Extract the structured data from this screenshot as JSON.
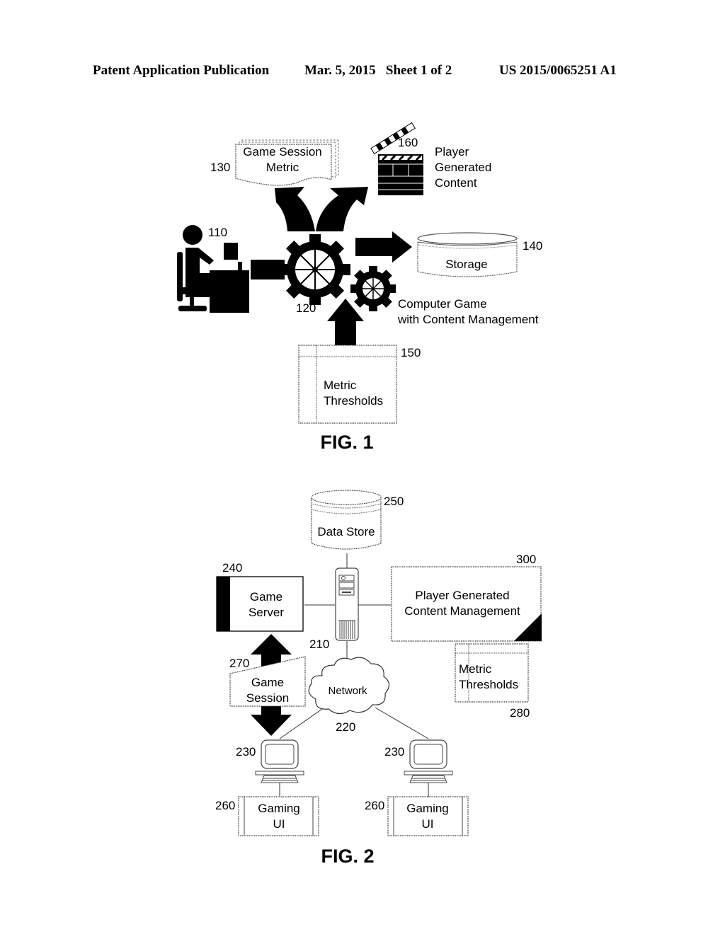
{
  "header": {
    "left": "Patent Application Publication",
    "middle": "Mar. 5, 2015   Sheet 1 of 2",
    "right": "US 2015/0065251 A1"
  },
  "fig1": {
    "caption": "FIG. 1",
    "game_session_metric": {
      "ref": "130",
      "line1": "Game Session",
      "line2": "Metric"
    },
    "player_generated_content": {
      "ref": "160",
      "line1": "Player",
      "line2": "Generated",
      "line3": "Content"
    },
    "user": {
      "ref": "110"
    },
    "storage": {
      "ref": "140",
      "label": "Storage"
    },
    "computer_game": {
      "ref": "120",
      "line1": "Computer Game",
      "line2": "with Content Management"
    },
    "metric_thresholds": {
      "ref": "150",
      "line1": "Metric",
      "line2": "Thresholds"
    }
  },
  "fig2": {
    "caption": "FIG. 2",
    "data_store": {
      "ref": "250",
      "label": "Data Store"
    },
    "game_server": {
      "ref": "240",
      "line1": "Game",
      "line2": "Server"
    },
    "pgc_management": {
      "ref": "300",
      "line1": "Player Generated",
      "line2": "Content Management"
    },
    "server": {
      "ref": "210"
    },
    "game_session": {
      "ref": "270",
      "line1": "Game",
      "line2": "Session"
    },
    "network": {
      "ref": "220",
      "label": "Network"
    },
    "metric_thresholds": {
      "ref": "280",
      "line1": "Metric",
      "line2": "Thresholds"
    },
    "clients": [
      {
        "ref": "230",
        "ui_ref": "260",
        "ui_line1": "Gaming",
        "ui_line2": "UI"
      },
      {
        "ref": "230",
        "ui_ref": "260",
        "ui_line1": "Gaming",
        "ui_line2": "UI"
      }
    ]
  }
}
